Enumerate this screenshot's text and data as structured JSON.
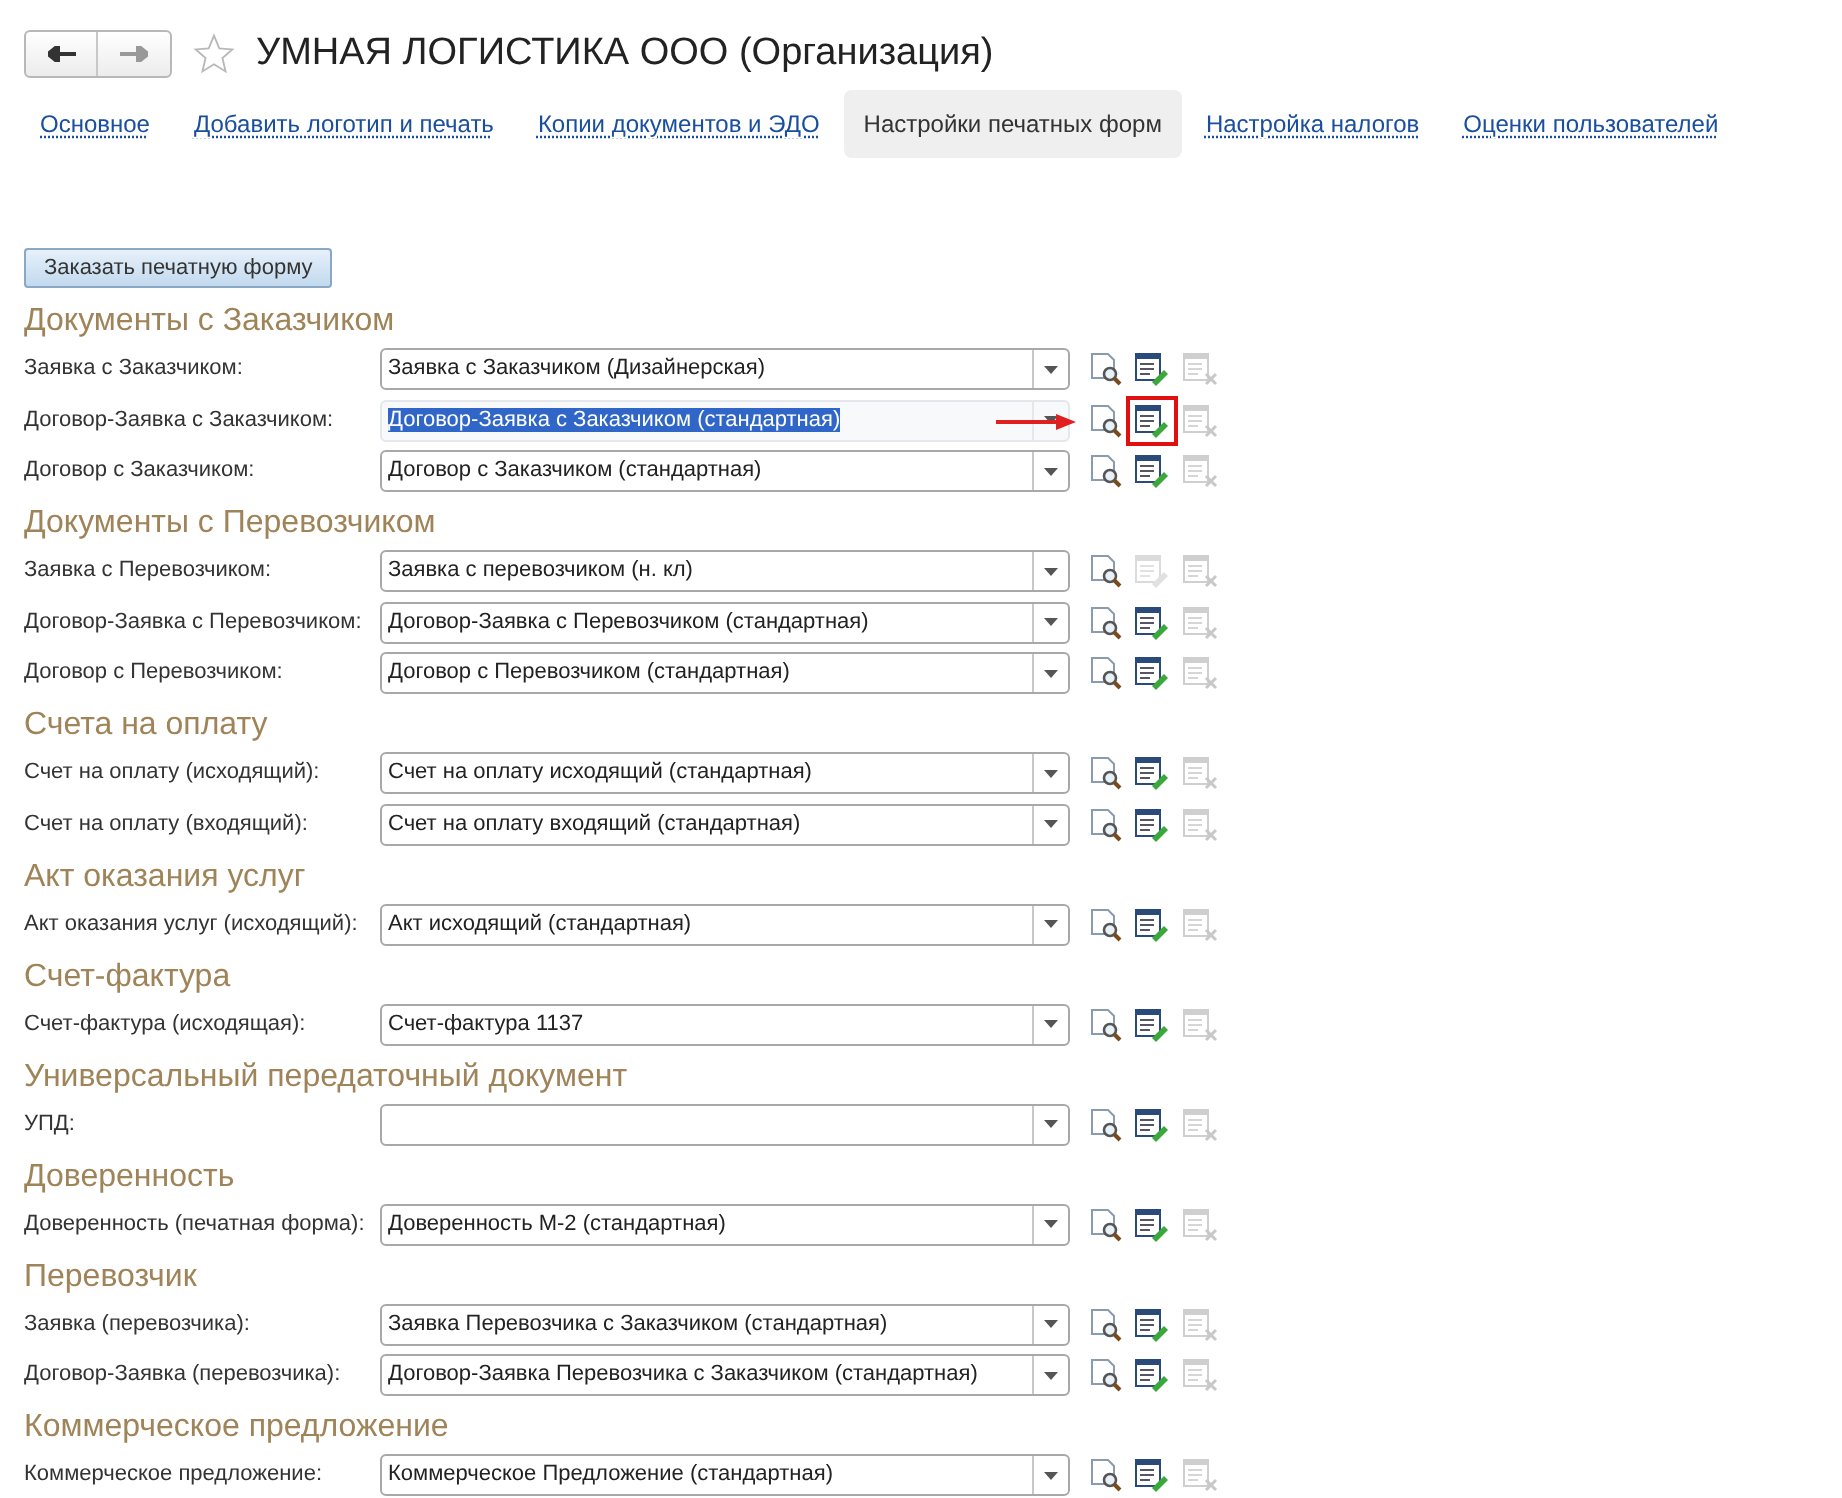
{
  "window": {
    "title": "УМНАЯ ЛОГИСТИКА ООО (Организация)",
    "favorite": false
  },
  "tabs": [
    {
      "label": "Основное",
      "selected": false
    },
    {
      "label": "Добавить логотип и печать",
      "selected": false
    },
    {
      "label": "Копии документов и ЭДО",
      "selected": false
    },
    {
      "label": "Настройки печатных форм",
      "selected": true
    },
    {
      "label": "Настройка налогов",
      "selected": false
    },
    {
      "label": "Оценки пользователей",
      "selected": false
    }
  ],
  "order_button": "Заказать печатную форму",
  "sections": [
    {
      "title": "Документы с Заказчиком",
      "rows": [
        {
          "label": "Заявка с Заказчиком:",
          "value": "Заявка с Заказчиком (Дизайнерская)",
          "focused": false,
          "edit_enabled": true,
          "delete_enabled": false,
          "highlighted": false
        },
        {
          "label": "Договор-Заявка с Заказчиком:",
          "value": "Договор-Заявка с Заказчиком (стандартная)",
          "focused": true,
          "edit_enabled": true,
          "delete_enabled": false,
          "highlighted": true
        },
        {
          "label": "Договор с Заказчиком:",
          "value": "Договор с Заказчиком (стандартная)",
          "focused": false,
          "edit_enabled": true,
          "delete_enabled": false,
          "highlighted": false
        }
      ]
    },
    {
      "title": "Документы с Перевозчиком",
      "rows": [
        {
          "label": "Заявка с Перевозчиком:",
          "value": "Заявка с перевозчиком (н. кл)",
          "focused": false,
          "edit_enabled": false,
          "delete_enabled": false,
          "highlighted": false
        },
        {
          "label": "Договор-Заявка с Перевозчиком:",
          "value": "Договор-Заявка с Перевозчиком (стандартная)",
          "focused": false,
          "edit_enabled": true,
          "delete_enabled": false,
          "highlighted": false
        },
        {
          "label": "Договор с Перевозчиком:",
          "value": "Договор с Перевозчиком (стандартная)",
          "focused": false,
          "edit_enabled": true,
          "delete_enabled": false,
          "highlighted": false
        }
      ]
    },
    {
      "title": "Счета на оплату",
      "rows": [
        {
          "label": "Счет на оплату (исходящий):",
          "value": "Счет на оплату исходящий (стандартная)",
          "focused": false,
          "edit_enabled": true,
          "delete_enabled": false,
          "highlighted": false
        },
        {
          "label": "Счет на оплату (входящий):",
          "value": "Счет на оплату входящий (стандартная)",
          "focused": false,
          "edit_enabled": true,
          "delete_enabled": false,
          "highlighted": false
        }
      ]
    },
    {
      "title": "Акт оказания услуг",
      "rows": [
        {
          "label": "Акт оказания услуг (исходящий):",
          "value": "Акт исходящий (стандартная)",
          "focused": false,
          "edit_enabled": true,
          "delete_enabled": false,
          "highlighted": false
        }
      ]
    },
    {
      "title": "Счет-фактура",
      "rows": [
        {
          "label": "Счет-фактура (исходящая):",
          "value": "Счет-фактура 1137",
          "focused": false,
          "edit_enabled": true,
          "delete_enabled": false,
          "highlighted": false
        }
      ]
    },
    {
      "title": "Универсальный передаточный документ",
      "rows": [
        {
          "label": "УПД:",
          "focused": false,
          "edit_enabled": true,
          "delete_enabled": false,
          "highlighted": false
        }
      ]
    },
    {
      "title": "Доверенность",
      "rows": [
        {
          "label": "Доверенность (печатная форма):",
          "value": "Доверенность М-2 (стандартная)",
          "focused": false,
          "edit_enabled": true,
          "delete_enabled": false,
          "highlighted": false
        }
      ]
    },
    {
      "title": "Перевозчик",
      "rows": [
        {
          "label": "Заявка (перевозчика):",
          "value": "Заявка Перевозчика с Заказчиком (стандартная)",
          "focused": false,
          "edit_enabled": true,
          "delete_enabled": false,
          "highlighted": false
        },
        {
          "label": "Договор-Заявка (перевозчика):",
          "value": "Договор-Заявка Перевозчика с Заказчиком (стандартная)",
          "focused": false,
          "edit_enabled": true,
          "delete_enabled": false,
          "highlighted": false
        }
      ]
    },
    {
      "title": "Коммерческое предложение",
      "rows": [
        {
          "label": "Коммерческое предложение:",
          "value": "Коммерческое Предложение (стандартная)",
          "focused": false,
          "edit_enabled": true,
          "delete_enabled": false,
          "highlighted": false
        }
      ]
    }
  ]
}
